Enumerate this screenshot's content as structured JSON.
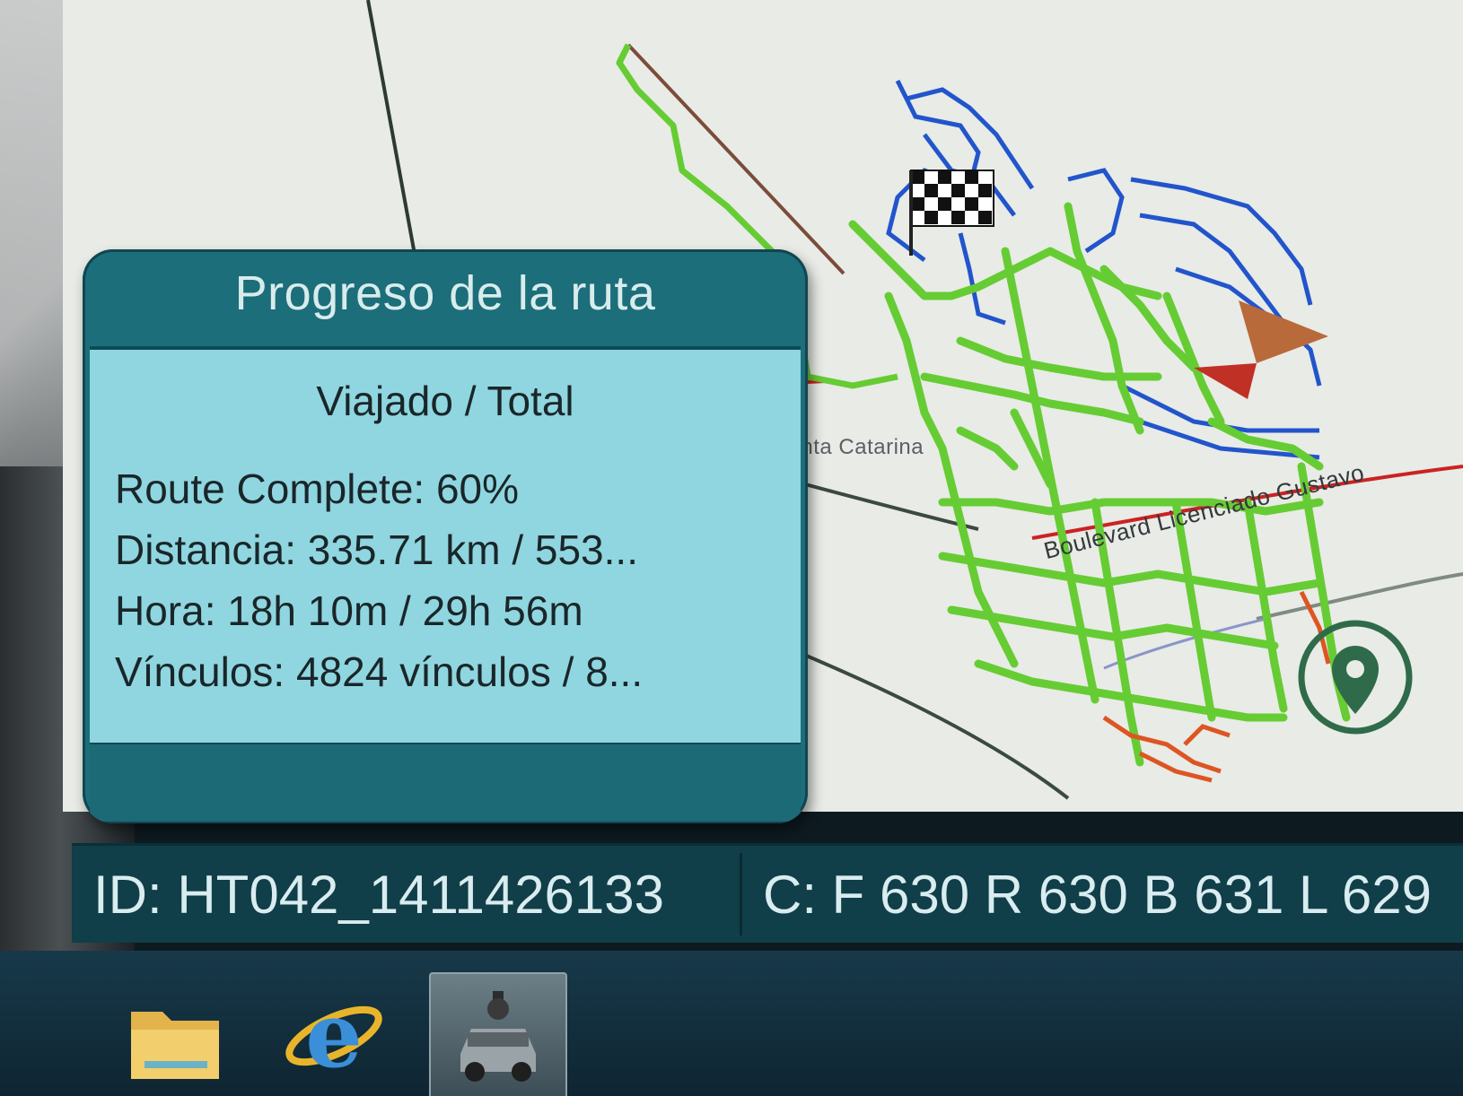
{
  "map": {
    "road_labels": {
      "santa_catarina": "Santa Catarina",
      "boulevard": "Boulevard Licenciado Gustavo"
    },
    "colors": {
      "background": "#e8ebe6",
      "route_completed": "#66cc33",
      "route_remaining": "#2255cc",
      "route_problem": "#dd5522",
      "road_major": "#3b4a3f",
      "road_highlight": "#cc2222"
    },
    "markers": [
      "checkered-flag-icon",
      "vehicle-arrow-icon",
      "location-pin-button"
    ]
  },
  "progress_panel": {
    "title": "Progreso de la ruta",
    "subtitle": "Viajado / Total",
    "route_complete": "Route Complete: 60%",
    "distance": "Distancia: 335.71 km / 553...",
    "time": "Hora: 18h 10m / 29h 56m",
    "links": "Vínculos: 4824 vínculos / 8...",
    "completion_percent": 60
  },
  "status_bar": {
    "id_label": "ID: HT042_1411426133",
    "counts_label": "C: F 630 R 630 B 631 L 629"
  },
  "taskbar": {
    "items": [
      {
        "name": "file-explorer-icon"
      },
      {
        "name": "internet-explorer-icon"
      },
      {
        "name": "capture-app-icon"
      }
    ]
  }
}
